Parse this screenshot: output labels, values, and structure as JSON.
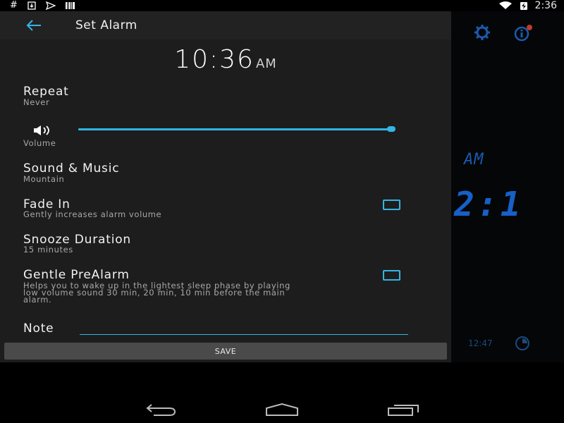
{
  "status_bar": {
    "left_icons": [
      "hash-icon",
      "download-icon",
      "send-icon",
      "barcode-icon"
    ],
    "right_icons": [
      "wifi-icon",
      "battery-charging-icon"
    ],
    "time": "2:36"
  },
  "dialog": {
    "title": "Set Alarm",
    "time": "10:36",
    "ampm": "AM",
    "repeat": {
      "label": "Repeat",
      "value": "Never"
    },
    "volume": {
      "label": "Volume",
      "level": 1.0
    },
    "sound": {
      "label": "Sound & Music",
      "value": "Mountain"
    },
    "fade_in": {
      "label": "Fade In",
      "description": "Gently increases alarm volume",
      "checked": false
    },
    "snooze": {
      "label": "Snooze Duration",
      "value": "15 minutes"
    },
    "prealarm": {
      "label": "Gentle PreAlarm",
      "description_lines": [
        "Helps you to wake up in the lightest sleep phase by playing",
        "low volume sound 30 min, 20 min, 10 min before the main",
        "alarm."
      ],
      "checked": false
    },
    "note": {
      "label": "Note",
      "value": ""
    },
    "save_label": "SAVE"
  },
  "background_app": {
    "ampm": "AM",
    "digits": "2:1",
    "next_alarm": "12:47"
  },
  "colors": {
    "accent": "#33b5e5",
    "dialog_bg": "#1d1d1d",
    "header_bg": "#222222",
    "button_bg": "#4a4a4a",
    "background_clock": "#1660c8"
  }
}
